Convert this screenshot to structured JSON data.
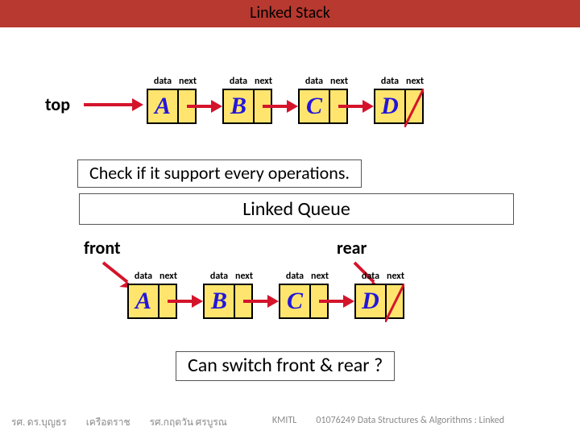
{
  "title": "Linked Stack",
  "stack": {
    "pointer_label": "top",
    "node_header": {
      "data": "data",
      "next": "next"
    },
    "nodes": [
      {
        "value": "A"
      },
      {
        "value": "B"
      },
      {
        "value": "C"
      },
      {
        "value": "D"
      }
    ],
    "note": "Check if it support every operations."
  },
  "queue": {
    "heading": "Linked Queue",
    "front_label": "front",
    "rear_label": "rear",
    "node_header": {
      "data": "data",
      "next": "next"
    },
    "nodes": [
      {
        "value": "A"
      },
      {
        "value": "B"
      },
      {
        "value": "C"
      },
      {
        "value": "D"
      }
    ],
    "note": "Can switch front & rear ?"
  },
  "footer": {
    "author1a": "รศ. ดร.บุญธร",
    "author1b": "เครือตราช",
    "author2": "รศ.กฤตวัน  ศรบูรณ",
    "inst": "KMITL",
    "course": "01076249 Data Structures & Algorithms : Linked"
  },
  "colors": {
    "accent": "#d4142b",
    "node_fill": "#ffe56e",
    "value": "#2316d9",
    "title_bg": "#b7392f"
  }
}
